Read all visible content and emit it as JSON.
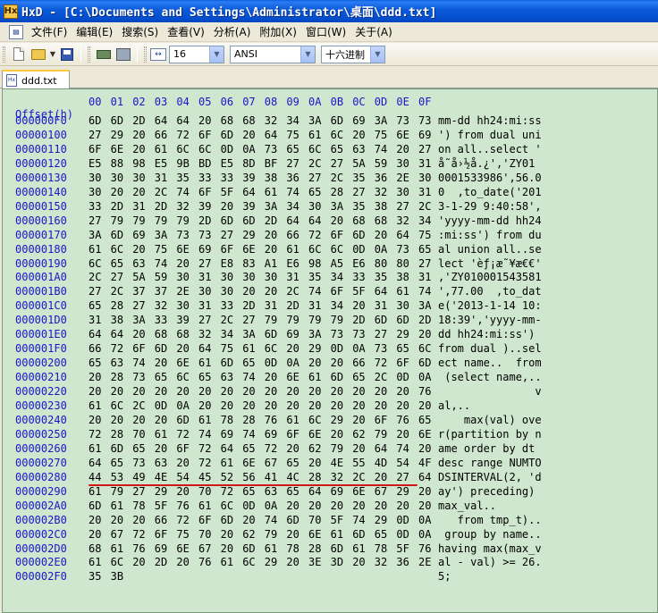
{
  "window": {
    "title": "HxD - [C:\\Documents and Settings\\Administrator\\桌面\\ddd.txt]",
    "app_icon_text": "Hx"
  },
  "menu": {
    "items": [
      {
        "label": "文件(F)",
        "name": "menu-file"
      },
      {
        "label": "编辑(E)",
        "name": "menu-edit"
      },
      {
        "label": "搜索(S)",
        "name": "menu-search"
      },
      {
        "label": "查看(V)",
        "name": "menu-view"
      },
      {
        "label": "分析(A)",
        "name": "menu-analysis"
      },
      {
        "label": "附加(X)",
        "name": "menu-extras"
      },
      {
        "label": "窗口(W)",
        "name": "menu-window"
      },
      {
        "label": "关于(A)",
        "name": "menu-about"
      }
    ]
  },
  "toolbar": {
    "bytes_per_row": "16",
    "charset": "ANSI",
    "offset_base": "十六进制"
  },
  "tab": {
    "label": "ddd.txt"
  },
  "hex": {
    "offset_header": "Offset(h)",
    "columns": [
      "00",
      "01",
      "02",
      "03",
      "04",
      "05",
      "06",
      "07",
      "08",
      "09",
      "0A",
      "0B",
      "0C",
      "0D",
      "0E",
      "0F"
    ],
    "rows": [
      {
        "offset": "000000F0",
        "bytes": [
          "6D",
          "6D",
          "2D",
          "64",
          "64",
          "20",
          "68",
          "68",
          "32",
          "34",
          "3A",
          "6D",
          "69",
          "3A",
          "73",
          "73"
        ],
        "text": "mm-dd hh24:mi:ss"
      },
      {
        "offset": "00000100",
        "bytes": [
          "27",
          "29",
          "20",
          "66",
          "72",
          "6F",
          "6D",
          "20",
          "64",
          "75",
          "61",
          "6C",
          "20",
          "75",
          "6E",
          "69"
        ],
        "text": "') from dual uni"
      },
      {
        "offset": "00000110",
        "bytes": [
          "6F",
          "6E",
          "20",
          "61",
          "6C",
          "6C",
          "0D",
          "0A",
          "73",
          "65",
          "6C",
          "65",
          "63",
          "74",
          "20",
          "27"
        ],
        "text": "on all..select '"
      },
      {
        "offset": "00000120",
        "bytes": [
          "E5",
          "88",
          "98",
          "E5",
          "9B",
          "BD",
          "E5",
          "8D",
          "BF",
          "27",
          "2C",
          "27",
          "5A",
          "59",
          "30",
          "31"
        ],
        "text": "å˜å›½å.¿','ZY01"
      },
      {
        "offset": "00000130",
        "bytes": [
          "30",
          "30",
          "30",
          "31",
          "35",
          "33",
          "33",
          "39",
          "38",
          "36",
          "27",
          "2C",
          "35",
          "36",
          "2E",
          "30"
        ],
        "text": "0001533986',56.0"
      },
      {
        "offset": "00000140",
        "bytes": [
          "30",
          "20",
          "20",
          "2C",
          "74",
          "6F",
          "5F",
          "64",
          "61",
          "74",
          "65",
          "28",
          "27",
          "32",
          "30",
          "31"
        ],
        "text": "0  ,to_date('201"
      },
      {
        "offset": "00000150",
        "bytes": [
          "33",
          "2D",
          "31",
          "2D",
          "32",
          "39",
          "20",
          "39",
          "3A",
          "34",
          "30",
          "3A",
          "35",
          "38",
          "27",
          "2C"
        ],
        "text": "3-1-29 9:40:58',"
      },
      {
        "offset": "00000160",
        "bytes": [
          "27",
          "79",
          "79",
          "79",
          "79",
          "2D",
          "6D",
          "6D",
          "2D",
          "64",
          "64",
          "20",
          "68",
          "68",
          "32",
          "34"
        ],
        "text": "'yyyy-mm-dd hh24"
      },
      {
        "offset": "00000170",
        "bytes": [
          "3A",
          "6D",
          "69",
          "3A",
          "73",
          "73",
          "27",
          "29",
          "20",
          "66",
          "72",
          "6F",
          "6D",
          "20",
          "64",
          "75"
        ],
        "text": ":mi:ss') from du"
      },
      {
        "offset": "00000180",
        "bytes": [
          "61",
          "6C",
          "20",
          "75",
          "6E",
          "69",
          "6F",
          "6E",
          "20",
          "61",
          "6C",
          "6C",
          "0D",
          "0A",
          "73",
          "65"
        ],
        "text": "al union all..se"
      },
      {
        "offset": "00000190",
        "bytes": [
          "6C",
          "65",
          "63",
          "74",
          "20",
          "27",
          "E8",
          "83",
          "A1",
          "E6",
          "98",
          "A5",
          "E6",
          "80",
          "80",
          "27"
        ],
        "text": "lect 'èƒ¡æ˜¥æ€€'"
      },
      {
        "offset": "000001A0",
        "bytes": [
          "2C",
          "27",
          "5A",
          "59",
          "30",
          "31",
          "30",
          "30",
          "30",
          "31",
          "35",
          "34",
          "33",
          "35",
          "38",
          "31"
        ],
        "text": ",'ZY010001543581"
      },
      {
        "offset": "000001B0",
        "bytes": [
          "27",
          "2C",
          "37",
          "37",
          "2E",
          "30",
          "30",
          "20",
          "20",
          "2C",
          "74",
          "6F",
          "5F",
          "64",
          "61",
          "74"
        ],
        "text": "',77.00  ,to_dat"
      },
      {
        "offset": "000001C0",
        "bytes": [
          "65",
          "28",
          "27",
          "32",
          "30",
          "31",
          "33",
          "2D",
          "31",
          "2D",
          "31",
          "34",
          "20",
          "31",
          "30",
          "3A"
        ],
        "text": "e('2013-1-14 10:"
      },
      {
        "offset": "000001D0",
        "bytes": [
          "31",
          "38",
          "3A",
          "33",
          "39",
          "27",
          "2C",
          "27",
          "79",
          "79",
          "79",
          "79",
          "2D",
          "6D",
          "6D",
          "2D"
        ],
        "text": "18:39','yyyy-mm-"
      },
      {
        "offset": "000001E0",
        "bytes": [
          "64",
          "64",
          "20",
          "68",
          "68",
          "32",
          "34",
          "3A",
          "6D",
          "69",
          "3A",
          "73",
          "73",
          "27",
          "29",
          "20"
        ],
        "text": "dd hh24:mi:ss') "
      },
      {
        "offset": "000001F0",
        "bytes": [
          "66",
          "72",
          "6F",
          "6D",
          "20",
          "64",
          "75",
          "61",
          "6C",
          "20",
          "29",
          "0D",
          "0A",
          "73",
          "65",
          "6C"
        ],
        "text": "from dual )..sel"
      },
      {
        "offset": "00000200",
        "bytes": [
          "65",
          "63",
          "74",
          "20",
          "6E",
          "61",
          "6D",
          "65",
          "0D",
          "0A",
          "20",
          "20",
          "66",
          "72",
          "6F",
          "6D"
        ],
        "text": "ect name..  from"
      },
      {
        "offset": "00000210",
        "bytes": [
          "20",
          "28",
          "73",
          "65",
          "6C",
          "65",
          "63",
          "74",
          "20",
          "6E",
          "61",
          "6D",
          "65",
          "2C",
          "0D",
          "0A"
        ],
        "text": " (select name,.."
      },
      {
        "offset": "00000220",
        "bytes": [
          "20",
          "20",
          "20",
          "20",
          "20",
          "20",
          "20",
          "20",
          "20",
          "20",
          "20",
          "20",
          "20",
          "20",
          "20",
          "76"
        ],
        "text": "               v"
      },
      {
        "offset": "00000230",
        "bytes": [
          "61",
          "6C",
          "2C",
          "0D",
          "0A",
          "20",
          "20",
          "20",
          "20",
          "20",
          "20",
          "20",
          "20",
          "20",
          "20",
          "20"
        ],
        "text": "al,..           "
      },
      {
        "offset": "00000240",
        "bytes": [
          "20",
          "20",
          "20",
          "20",
          "6D",
          "61",
          "78",
          "28",
          "76",
          "61",
          "6C",
          "29",
          "20",
          "6F",
          "76",
          "65"
        ],
        "text": "    max(val) ove"
      },
      {
        "offset": "00000250",
        "bytes": [
          "72",
          "28",
          "70",
          "61",
          "72",
          "74",
          "69",
          "74",
          "69",
          "6F",
          "6E",
          "20",
          "62",
          "79",
          "20",
          "6E"
        ],
        "text": "r(partition by n"
      },
      {
        "offset": "00000260",
        "bytes": [
          "61",
          "6D",
          "65",
          "20",
          "6F",
          "72",
          "64",
          "65",
          "72",
          "20",
          "62",
          "79",
          "20",
          "64",
          "74",
          "20"
        ],
        "text": "ame order by dt "
      },
      {
        "offset": "00000270",
        "bytes": [
          "64",
          "65",
          "73",
          "63",
          "20",
          "72",
          "61",
          "6E",
          "67",
          "65",
          "20",
          "4E",
          "55",
          "4D",
          "54",
          "4F"
        ],
        "text": "desc range NUMTO"
      },
      {
        "offset": "00000280",
        "bytes": [
          "44",
          "53",
          "49",
          "4E",
          "54",
          "45",
          "52",
          "56",
          "41",
          "4C",
          "28",
          "32",
          "2C",
          "20",
          "27",
          "64"
        ],
        "text": "DSINTERVAL(2, 'd"
      },
      {
        "offset": "00000290",
        "bytes": [
          "61",
          "79",
          "27",
          "29",
          "20",
          "70",
          "72",
          "65",
          "63",
          "65",
          "64",
          "69",
          "6E",
          "67",
          "29",
          "20"
        ],
        "text": "ay') preceding) "
      },
      {
        "offset": "000002A0",
        "bytes": [
          "6D",
          "61",
          "78",
          "5F",
          "76",
          "61",
          "6C",
          "0D",
          "0A",
          "20",
          "20",
          "20",
          "20",
          "20",
          "20",
          "20"
        ],
        "text": "max_val..       "
      },
      {
        "offset": "000002B0",
        "bytes": [
          "20",
          "20",
          "20",
          "66",
          "72",
          "6F",
          "6D",
          "20",
          "74",
          "6D",
          "70",
          "5F",
          "74",
          "29",
          "0D",
          "0A"
        ],
        "text": "   from tmp_t).."
      },
      {
        "offset": "000002C0",
        "bytes": [
          "20",
          "67",
          "72",
          "6F",
          "75",
          "70",
          "20",
          "62",
          "79",
          "20",
          "6E",
          "61",
          "6D",
          "65",
          "0D",
          "0A"
        ],
        "text": " group by name.."
      },
      {
        "offset": "000002D0",
        "bytes": [
          "68",
          "61",
          "76",
          "69",
          "6E",
          "67",
          "20",
          "6D",
          "61",
          "78",
          "28",
          "6D",
          "61",
          "78",
          "5F",
          "76"
        ],
        "text": "having max(max_v"
      },
      {
        "offset": "000002E0",
        "bytes": [
          "61",
          "6C",
          "20",
          "2D",
          "20",
          "76",
          "61",
          "6C",
          "29",
          "20",
          "3E",
          "3D",
          "20",
          "32",
          "36",
          "2E"
        ],
        "text": "al - val) >= 26."
      },
      {
        "offset": "000002F0",
        "bytes": [
          "35",
          "3B"
        ],
        "text": "5;"
      }
    ]
  },
  "colors": {
    "editor_background": "#cfe6cf",
    "offset_text": "#1818c8",
    "annotation_underline": "#d01818"
  }
}
